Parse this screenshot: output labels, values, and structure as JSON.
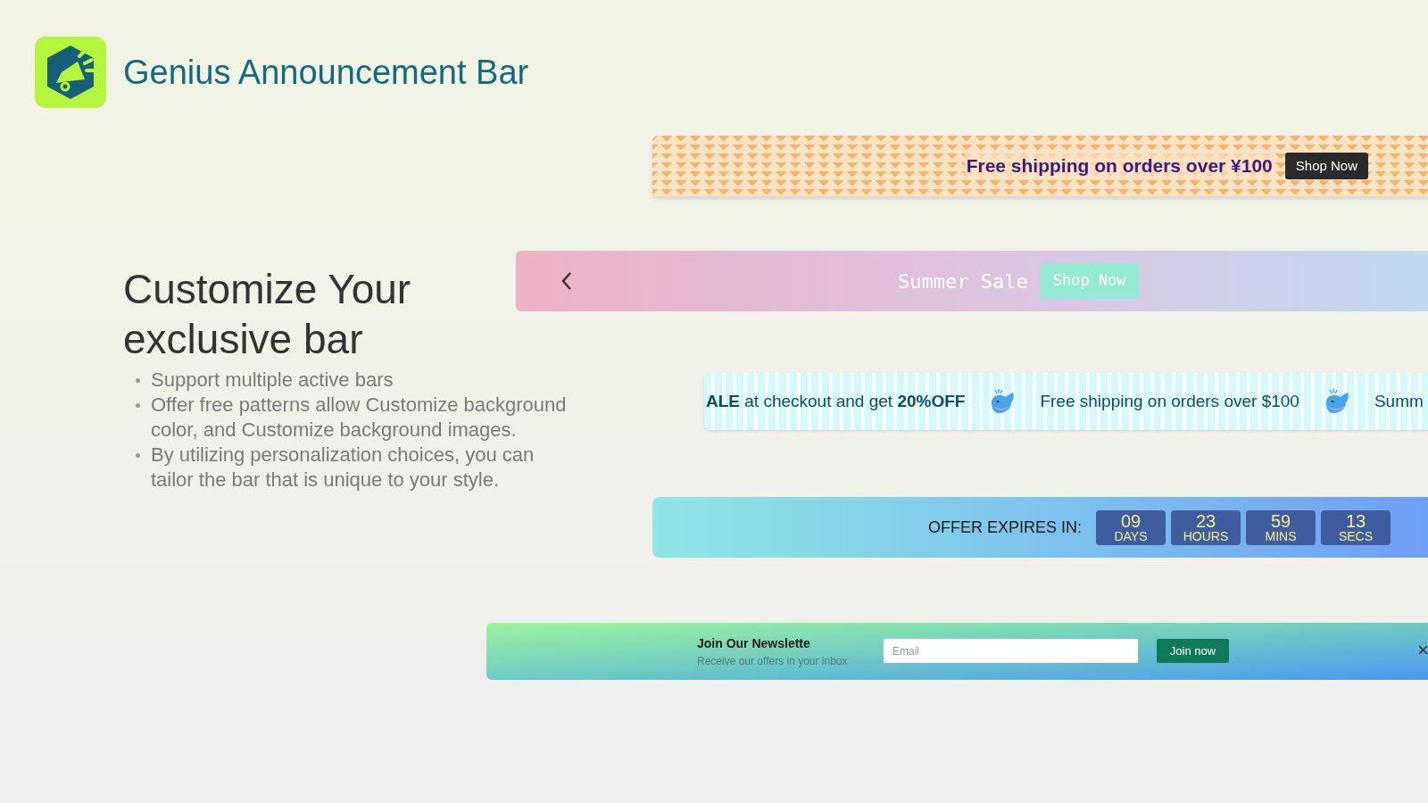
{
  "app": {
    "name": "Genius Announcement Bar"
  },
  "intro": {
    "heading": "Customize Your exclusive bar",
    "points": [
      "Support multiple active bars",
      "Offer free patterns allow Customize background color, and Customize background images.",
      "By utilizing personalization choices, you can tailor the bar that is unique to your style."
    ]
  },
  "bars": [
    {
      "kind": "pattern",
      "message": "Free shipping on orders over ¥100",
      "button": "Shop Now"
    },
    {
      "kind": "slider",
      "message": "Summer Sale",
      "button": "Shop Now"
    },
    {
      "kind": "marquee",
      "items": [
        "**ALE** at checkout and get **20%OFF**",
        "Free shipping on orders over $100",
        "Summ"
      ]
    },
    {
      "kind": "countdown",
      "label": "OFFER EXPIRES IN:",
      "units": [
        {
          "value": "09",
          "unit": "DAYS"
        },
        {
          "value": "23",
          "unit": "HOURS"
        },
        {
          "value": "59",
          "unit": "MINS"
        },
        {
          "value": "13",
          "unit": "SECS"
        }
      ]
    },
    {
      "kind": "newsletter",
      "title": "Join Our Newslette",
      "subtitle": "Receive our offers in your inbox",
      "placeholder": "Email",
      "button": "Join now",
      "close": "×"
    }
  ]
}
